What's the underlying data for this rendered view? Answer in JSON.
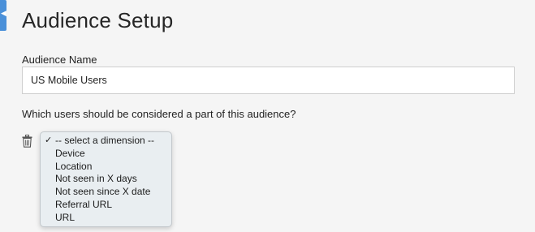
{
  "header": {
    "title": "Audience Setup",
    "collapse_icon": "chevron-left-icon"
  },
  "form": {
    "name_label": "Audience Name",
    "name_value": "US Mobile Users",
    "question": "Which users should be considered a part of this audience?"
  },
  "condition": {
    "delete_icon": "trash-icon",
    "dropdown": {
      "selected": "-- select a dimension --",
      "check_mark": "✓",
      "options": [
        {
          "label": "-- select a dimension --",
          "checked": true
        },
        {
          "label": "Device",
          "checked": false
        },
        {
          "label": "Location",
          "checked": false
        },
        {
          "label": "Not seen in X days",
          "checked": false
        },
        {
          "label": "Not seen since X date",
          "checked": false
        },
        {
          "label": "Referral URL",
          "checked": false
        },
        {
          "label": "URL",
          "checked": false
        }
      ]
    }
  },
  "colors": {
    "accent": "#4a90d9",
    "page_background": "#f5f5f5",
    "dropdown_background": "#e9eef1"
  }
}
